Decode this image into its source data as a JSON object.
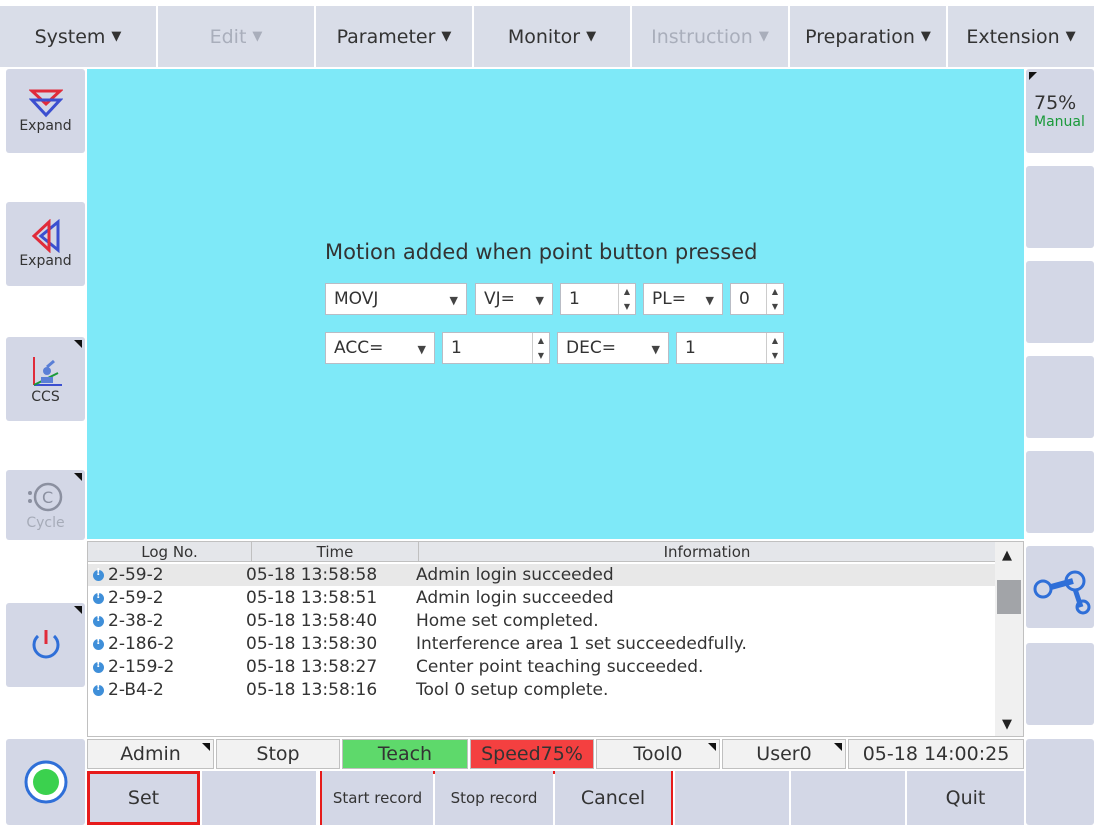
{
  "menu": [
    {
      "label": "System",
      "caret": "▼",
      "disabled": false
    },
    {
      "label": "Edit",
      "caret": "▼",
      "disabled": true
    },
    {
      "label": "Parameter",
      "caret": "▼",
      "disabled": false
    },
    {
      "label": "Monitor",
      "caret": "▼",
      "disabled": false
    },
    {
      "label": "Instruction",
      "caret": "▼",
      "disabled": true
    },
    {
      "label": "Preparation",
      "caret": "▼",
      "disabled": false
    },
    {
      "label": "Extension",
      "caret": "▼",
      "disabled": false
    }
  ],
  "left_sidebar": {
    "expand1": "Expand",
    "expand2": "Expand",
    "ccs": "CCS",
    "cycle": "Cycle"
  },
  "right_sidebar": {
    "speed": "75%",
    "mode": "Manual"
  },
  "motion": {
    "title": "Motion added when point button pressed",
    "type": "MOVJ",
    "vj_label": "VJ=",
    "vj_value": "1",
    "pl_label": "PL=",
    "pl_value": "0",
    "acc_label": "ACC=",
    "acc_value": "1",
    "dec_label": "DEC=",
    "dec_value": "1"
  },
  "log": {
    "headers": {
      "no": "Log No.",
      "time": "Time",
      "info": "Information"
    },
    "rows": [
      {
        "no": "2-59-2",
        "time": "05-18 13:58:58",
        "info": "Admin  login succeeded"
      },
      {
        "no": "2-59-2",
        "time": "05-18 13:58:51",
        "info": "Admin  login succeeded"
      },
      {
        "no": "2-38-2",
        "time": "05-18 13:58:40",
        "info": "Home set completed."
      },
      {
        "no": "2-186-2",
        "time": "05-18 13:58:30",
        "info": "Interference area 1 set succeededfully."
      },
      {
        "no": "2-159-2",
        "time": "05-18 13:58:27",
        "info": "Center point teaching succeeded."
      },
      {
        "no": "2-B4-2",
        "time": "05-18 13:58:16",
        "info": "Tool 0 setup complete."
      }
    ]
  },
  "status": {
    "user": "Admin",
    "run": "Stop",
    "mode": "Teach",
    "speed": "Speed75%",
    "tool": "Tool0",
    "userframe": "User0",
    "datetime": "05-18 14:00:25"
  },
  "functions": {
    "set": "Set",
    "start_record": "Start record",
    "stop_record": "Stop record",
    "cancel": "Cancel",
    "quit": "Quit"
  },
  "colors": {
    "main_bg": "#7ee9f8",
    "teach": "#5ed96b",
    "speed": "#f44040",
    "highlight": "#e61b1b"
  }
}
